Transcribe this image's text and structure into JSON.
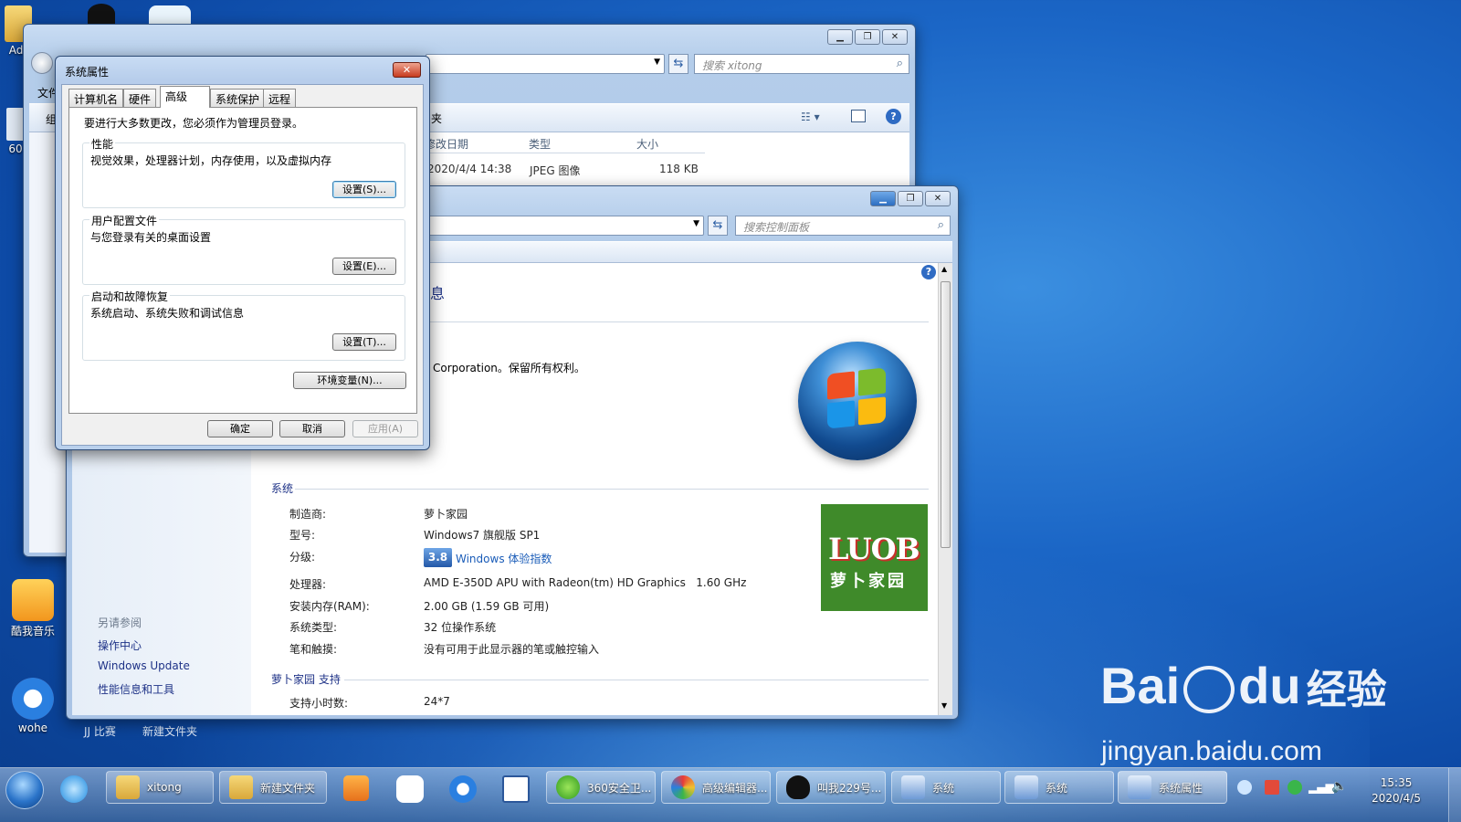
{
  "desktop": {
    "icons": [
      {
        "label": "Adr",
        "icon": "folder-icon"
      },
      {
        "label": "60",
        "icon": "shortcut-icon"
      },
      {
        "label": "酷我音乐",
        "icon": "kuwo-music-icon"
      },
      {
        "label": "wohe",
        "icon": "sogou-icon"
      }
    ],
    "bottom_labels": [
      "JJ 比赛",
      "新建文件夹"
    ]
  },
  "explorer": {
    "menu_partial": "文件",
    "toolbar_partial": "组",
    "search_placeholder": "搜索 xitong",
    "pane_partial": "夹",
    "columns": [
      "修改日期",
      "类型",
      "大小"
    ],
    "rows": [
      {
        "date": "2020/4/4 14:38",
        "type": "JPEG 图像",
        "size": "118 KB"
      }
    ]
  },
  "control_panel": {
    "search_placeholder": "搜索控制面板",
    "heading_partial": "息",
    "copyright_partial": "Corporation。保留所有权利。",
    "see_also": {
      "title": "另请参阅",
      "links": [
        "操作中心",
        "Windows Update",
        "性能信息和工具"
      ]
    },
    "system_section": {
      "title": "系统",
      "rows": [
        {
          "label": "制造商:",
          "value": "萝卜家园"
        },
        {
          "label": "型号:",
          "value": "Windows7 旗舰版 SP1"
        },
        {
          "label": "分级:",
          "value": "Windows 体验指数",
          "score": "3.8"
        },
        {
          "label": "处理器:",
          "value": "AMD E-350D APU with Radeon(tm) HD Graphics   1.60 GHz"
        },
        {
          "label": "安装内存(RAM):",
          "value": "2.00 GB (1.59 GB 可用)"
        },
        {
          "label": "系统类型:",
          "value": "32 位操作系统"
        },
        {
          "label": "笔和触摸:",
          "value": "没有可用于此显示器的笔或触控输入"
        }
      ]
    },
    "support_section": {
      "title": "萝卜家园 支持",
      "rows": [
        {
          "label": "支持小时数:",
          "value": "24*7"
        }
      ]
    },
    "oem_logo": {
      "brand": "LUOB",
      "subtitle": "萝卜家园",
      "bg_color": "#3f8a2a"
    }
  },
  "dialog": {
    "title": "系统属性",
    "tabs": [
      "计算机名",
      "硬件",
      "高级",
      "系统保护",
      "远程"
    ],
    "active_tab": "高级",
    "admin_note": "要进行大多数更改，您必须作为管理员登录。",
    "groups": [
      {
        "title": "性能",
        "desc": "视觉效果，处理器计划，内存使用，以及虚拟内存",
        "button": "设置(S)..."
      },
      {
        "title": "用户配置文件",
        "desc": "与您登录有关的桌面设置",
        "button": "设置(E)..."
      },
      {
        "title": "启动和故障恢复",
        "desc": "系统启动、系统失败和调试信息",
        "button": "设置(T)..."
      }
    ],
    "env_button": "环境变量(N)...",
    "ok": "确定",
    "cancel": "取消",
    "apply": "应用(A)"
  },
  "taskbar": {
    "items": [
      {
        "label": "xitong",
        "icon": "folder-icon"
      },
      {
        "label": "新建文件夹",
        "icon": "folder-icon"
      },
      {
        "label": "360安全卫...",
        "icon": "360-icon"
      },
      {
        "label": "高级编辑器...",
        "icon": "editor-icon"
      },
      {
        "label": "叫我229号...",
        "icon": "qq-icon"
      },
      {
        "label": "系统",
        "icon": "system-icon"
      },
      {
        "label": "系统",
        "icon": "system-icon"
      },
      {
        "label": "系统属性",
        "icon": "system-icon"
      }
    ],
    "time": "15:35",
    "date": "2020/4/5"
  },
  "watermark": {
    "brand": "Bai",
    "brand2": "du",
    "cn": "经验",
    "url": "jingyan.baidu.com"
  }
}
